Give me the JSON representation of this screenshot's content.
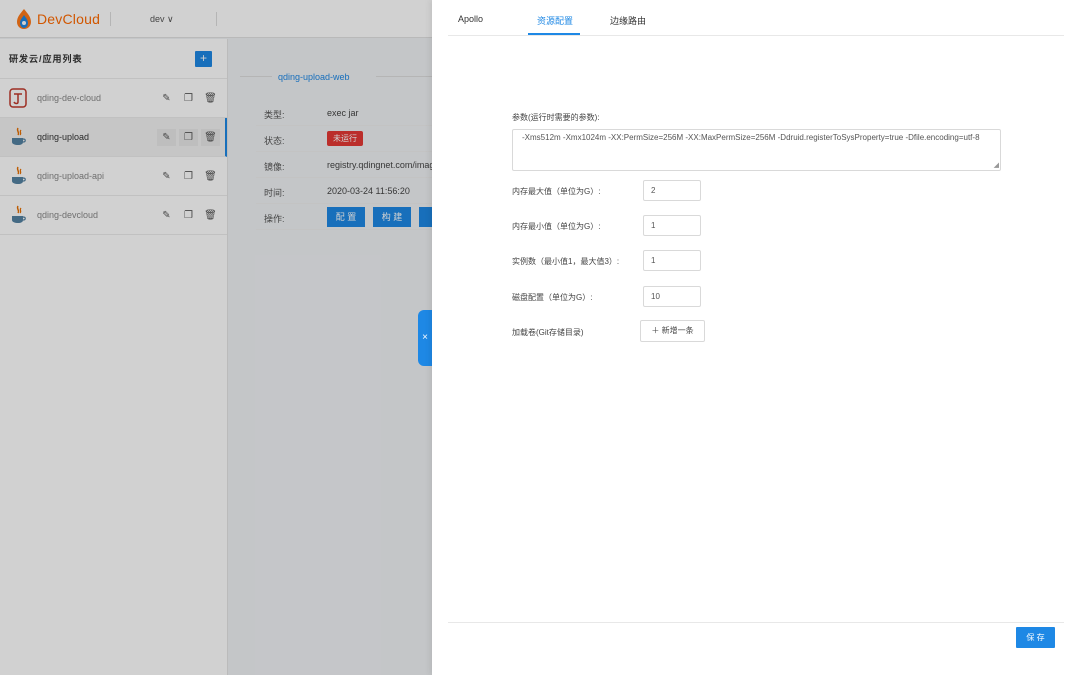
{
  "brand": {
    "name": "DevCloud",
    "accent": "#ff6a00"
  },
  "header": {
    "env": "dev ∨"
  },
  "sidebar": {
    "title": "研发云/应用列表",
    "add_label": "+",
    "items": [
      {
        "name": "qding-dev-cloud",
        "icon": "jenkins-icon",
        "active": false
      },
      {
        "name": "qding-upload",
        "icon": "java-icon",
        "active": true
      },
      {
        "name": "qding-upload-api",
        "icon": "java-icon",
        "active": false
      },
      {
        "name": "qding-devcloud",
        "icon": "java-icon",
        "active": false
      }
    ]
  },
  "detail": {
    "title": "qding-upload-web",
    "rows": [
      {
        "label": "类型:",
        "value": "exec jar"
      },
      {
        "label": "状态:",
        "value": "未运行"
      },
      {
        "label": "镜像:",
        "value": "registry.qdingnet.com/imag"
      },
      {
        "label": "时间:",
        "value": "2020-03-24 11:56:20"
      },
      {
        "label": "操作:",
        "value": ""
      }
    ],
    "buttons": [
      "配 置",
      "构 建"
    ]
  },
  "drawer": {
    "close_label": "×",
    "tabs": [
      "Apollo",
      "资源配置",
      "边缘路由"
    ],
    "active_tab": 1,
    "jvm_label": "参数(运行时需要的参数):",
    "jvm_value": "-Xms512m -Xmx1024m -XX:PermSize=256M -XX:MaxPermSize=256M -Ddruid.registerToSysProperty=true -Dfile.encoding=utf-8",
    "fields": [
      {
        "label": "内存最大值（单位为G）:",
        "value": "2"
      },
      {
        "label": "内存最小值（单位为G）:",
        "value": "1"
      },
      {
        "label": "实例数（最小值1，最大值3）:",
        "value": "1"
      },
      {
        "label": "磁盘配置（单位为G）:",
        "value": "10"
      }
    ],
    "volume_label": "加载卷(Git存储目录)",
    "add_row_label": "＋ 新增一条",
    "save_label": "保 存"
  }
}
